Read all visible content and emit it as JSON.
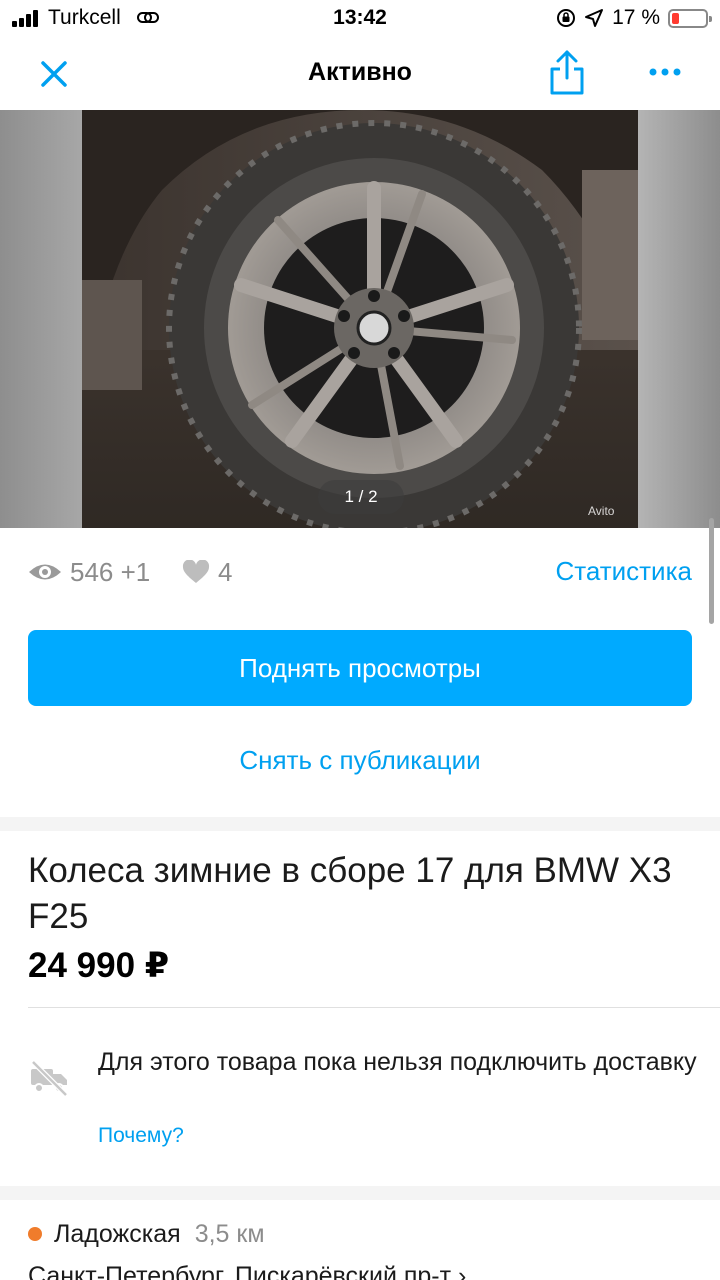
{
  "status_bar": {
    "carrier": "Turkcell",
    "time": "13:42",
    "battery": "17 %"
  },
  "nav": {
    "title": "Активно",
    "icons": [
      "close-icon",
      "share-icon",
      "more-icon"
    ]
  },
  "gallery": {
    "counter": "1 / 2",
    "watermark": "Avito"
  },
  "stats": {
    "views": "546 +1",
    "favorites": "4",
    "link": "Статистика"
  },
  "actions": {
    "raise_button": "Поднять просмотры",
    "unpublish_link": "Снять с публикации"
  },
  "listing": {
    "title": "Колеса зимние в сборе 17 для BMW X3 F25",
    "price": "24 990 ₽"
  },
  "delivery": {
    "message": "Для этого товара пока нельзя подключить доставку",
    "why_link": "Почему?"
  },
  "location": {
    "metro_station": "Ладожская",
    "metro_color": "#f07c2b",
    "distance": "3,5 км",
    "address": "Санкт-Петербург, Пискарёвский пр-т"
  },
  "colors": {
    "accent": "#00aaff",
    "link": "#00a0f0",
    "muted": "#8c8c8c"
  }
}
